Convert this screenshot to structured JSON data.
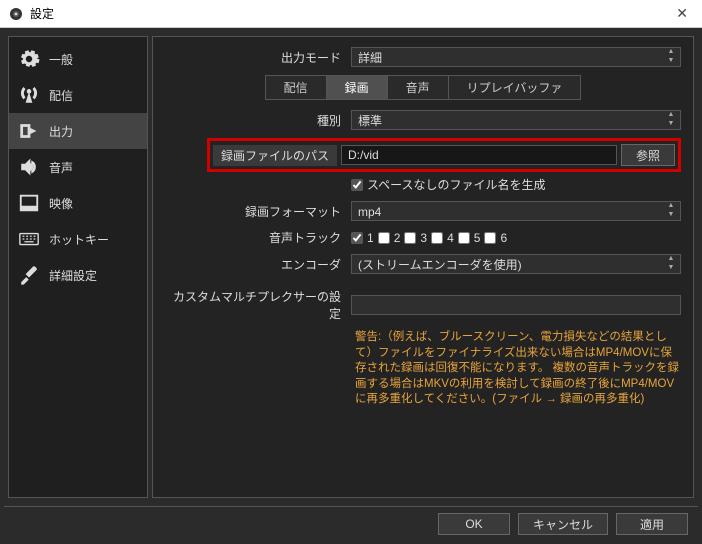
{
  "window": {
    "title": "設定"
  },
  "sidebar": {
    "items": [
      {
        "label": "一般"
      },
      {
        "label": "配信"
      },
      {
        "label": "出力"
      },
      {
        "label": "音声"
      },
      {
        "label": "映像"
      },
      {
        "label": "ホットキー"
      },
      {
        "label": "詳細設定"
      }
    ]
  },
  "output_mode": {
    "label": "出力モード",
    "value": "詳細"
  },
  "tabs": {
    "stream": "配信",
    "record": "録画",
    "audio": "音声",
    "replay": "リプレイバッファ"
  },
  "recording": {
    "kind_label": "種別",
    "kind_value": "標準",
    "path_label": "録画ファイルのパス",
    "path_value": "D:/vid",
    "browse": "参照",
    "no_space_label": "スペースなしのファイル名を生成",
    "no_space_checked": true,
    "format_label": "録画フォーマット",
    "format_value": "mp4",
    "tracks_label": "音声トラック",
    "tracks": [
      {
        "label": "1",
        "checked": true
      },
      {
        "label": "2",
        "checked": false
      },
      {
        "label": "3",
        "checked": false
      },
      {
        "label": "4",
        "checked": false
      },
      {
        "label": "5",
        "checked": false
      },
      {
        "label": "6",
        "checked": false
      }
    ],
    "encoder_label": "エンコーダ",
    "encoder_value": "(ストリームエンコーダを使用)",
    "muxer_label": "カスタムマルチプレクサーの設定",
    "warning": "警告:（例えば、ブルースクリーン、電力損失などの結果として）ファイルをファイナライズ出来ない場合はMP4/MOVに保存された録画は回復不能になります。 複数の音声トラックを録画する場合はMKVの利用を検討して録画の終了後にMP4/MOVに再多重化してください。(ファイル → 録画の再多重化)"
  },
  "footer": {
    "ok": "OK",
    "cancel": "キャンセル",
    "apply": "適用"
  }
}
